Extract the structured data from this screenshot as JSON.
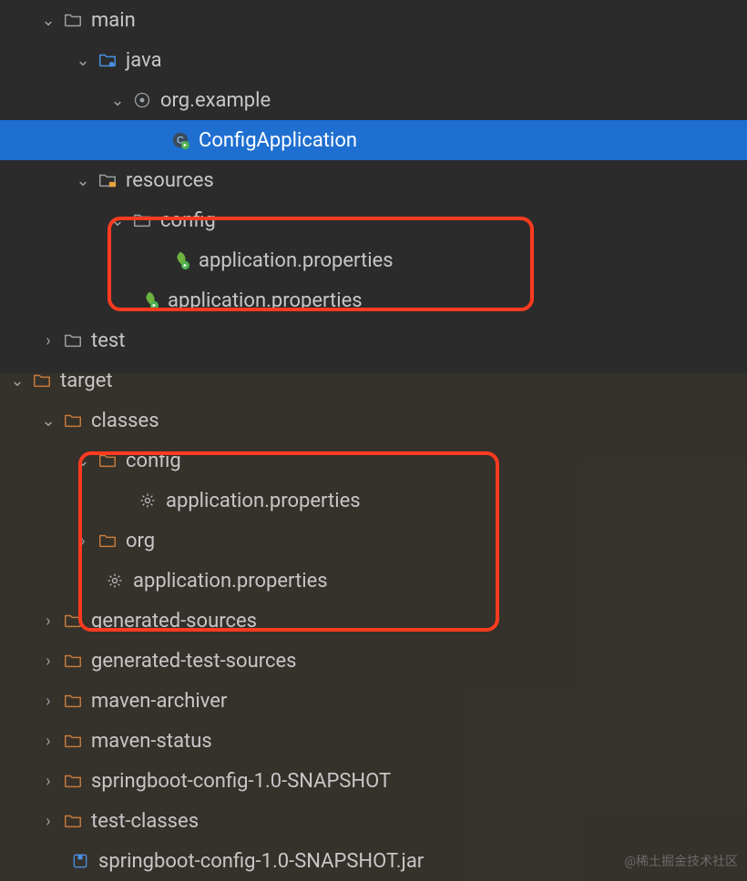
{
  "tree": {
    "src_main": "main",
    "java": "java",
    "pkg": "org.example",
    "cls": "ConfigApplication",
    "resources": "resources",
    "res_config": "config",
    "res_config_file": "application.properties",
    "res_file": "application.properties",
    "test": "test",
    "target": "target",
    "classes": "classes",
    "cls_config": "config",
    "cls_config_file": "application.properties",
    "cls_org": "org",
    "cls_file": "application.properties",
    "gen_sources": "generated-sources",
    "gen_test_sources": "generated-test-sources",
    "maven_archiver": "maven-archiver",
    "maven_status": "maven-status",
    "snapshot_dir": "springboot-config-1.0-SNAPSHOT",
    "test_classes": "test-classes",
    "jar": "springboot-config-1.0-SNAPSHOT.jar"
  },
  "watermark": "@稀土掘金技术社区",
  "colors": {
    "bg": "#2b2b2b",
    "selection": "#1f6fd1",
    "highlight": "#ff3b1f",
    "folder_gray": "#9aa0a6",
    "folder_blue": "#4a90e2",
    "folder_orange": "#c77b3a",
    "spring_green": "#6db33f"
  }
}
